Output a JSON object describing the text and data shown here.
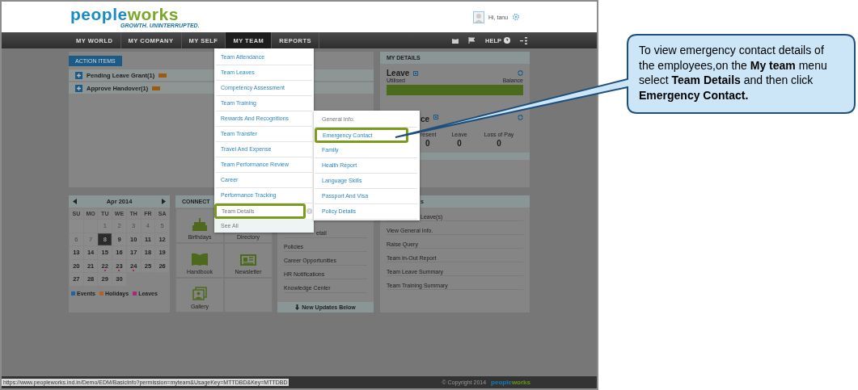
{
  "header": {
    "logo": "peopleworks",
    "tagline": "GROWTH. UNINTERRUPTED.",
    "greeting": "Hi, tanu"
  },
  "nav": {
    "items": [
      {
        "label": "MY WORLD",
        "selected": false
      },
      {
        "label": "MY COMPANY",
        "selected": false
      },
      {
        "label": "MY SELF",
        "selected": false
      },
      {
        "label": "MY TEAM",
        "selected": true
      },
      {
        "label": "REPORTS",
        "selected": false
      }
    ],
    "help": "HELP"
  },
  "action_items": {
    "tab": "ACTION ITEMS",
    "items": [
      {
        "label": "Pending Leave Grant(1)"
      },
      {
        "label": "Approve Handover(1)"
      }
    ]
  },
  "my_details": {
    "title": "MY DETAILS",
    "leave": {
      "title": "Leave",
      "utilised": "Utilised",
      "balance": "Balance",
      "level": 1
    },
    "attendance": {
      "title": "ce",
      "stats": [
        {
          "label": "resent",
          "value": "0"
        },
        {
          "label": "Leave",
          "value": "0"
        },
        {
          "label": "Loss of Pay",
          "value": "0"
        }
      ]
    }
  },
  "calendar": {
    "month": "Apr 2014",
    "weekdays": [
      "SU",
      "MO",
      "TU",
      "WE",
      "TH",
      "FR",
      "SA"
    ],
    "cells": [
      {
        "kind": "blank"
      },
      {
        "kind": "blank"
      },
      {
        "kind": "day",
        "day": "1",
        "muted": true,
        "selected": false
      },
      {
        "kind": "day",
        "day": "2",
        "muted": true,
        "selected": false
      },
      {
        "kind": "day",
        "day": "3",
        "muted": true,
        "selected": false
      },
      {
        "kind": "day",
        "day": "4",
        "muted": true,
        "selected": false
      },
      {
        "kind": "day",
        "day": "5",
        "muted": true,
        "selected": false
      },
      {
        "kind": "day",
        "day": "6",
        "muted": true,
        "selected": false
      },
      {
        "kind": "day",
        "day": "7",
        "muted": true,
        "selected": false
      },
      {
        "kind": "day",
        "day": "8",
        "muted": false,
        "selected": true
      },
      {
        "kind": "day",
        "day": "9",
        "muted": false,
        "selected": false
      },
      {
        "kind": "day",
        "day": "10",
        "muted": false,
        "selected": false
      },
      {
        "kind": "day",
        "day": "11",
        "muted": false,
        "selected": false
      },
      {
        "kind": "day",
        "day": "12",
        "muted": false,
        "selected": false
      },
      {
        "kind": "day",
        "day": "13",
        "muted": false,
        "selected": false
      },
      {
        "kind": "day",
        "day": "14",
        "muted": false,
        "selected": false
      },
      {
        "kind": "day",
        "day": "15",
        "muted": false,
        "selected": false
      },
      {
        "kind": "day",
        "day": "16",
        "muted": false,
        "selected": false
      },
      {
        "kind": "day",
        "day": "17",
        "muted": false,
        "selected": false
      },
      {
        "kind": "day",
        "day": "18",
        "muted": false,
        "selected": false
      },
      {
        "kind": "day",
        "day": "19",
        "muted": false,
        "selected": false
      },
      {
        "kind": "day",
        "day": "20",
        "muted": false,
        "selected": false
      },
      {
        "kind": "day",
        "day": "21",
        "muted": false,
        "selected": false
      },
      {
        "kind": "day",
        "day": "22",
        "muted": false,
        "selected": false,
        "color": "#a8287a"
      },
      {
        "kind": "day",
        "day": "23",
        "muted": false,
        "selected": false,
        "color": "#a8287a"
      },
      {
        "kind": "day",
        "day": "24",
        "muted": false,
        "selected": false,
        "color": "#a8287a"
      },
      {
        "kind": "day",
        "day": "25",
        "muted": false,
        "selected": false
      },
      {
        "kind": "day",
        "day": "26",
        "muted": false,
        "selected": false
      },
      {
        "kind": "day",
        "day": "27",
        "muted": false,
        "selected": false
      },
      {
        "kind": "day",
        "day": "28",
        "muted": false,
        "selected": false
      },
      {
        "kind": "day",
        "day": "29",
        "muted": false,
        "selected": false
      },
      {
        "kind": "day",
        "day": "30",
        "muted": false,
        "selected": false
      }
    ],
    "legend": [
      {
        "label": "Events",
        "color": "#1f63a0"
      },
      {
        "label": "Holidays",
        "color": "#b0621e"
      },
      {
        "label": "Leaves",
        "color": "#a8287a"
      }
    ]
  },
  "connect": {
    "title": "CONNECT",
    "tiles": [
      {
        "kind": "cake",
        "label": "Birthdays"
      },
      {
        "kind": "none",
        "label": "Directory"
      },
      {
        "kind": "book",
        "label": "Handbook"
      },
      {
        "kind": "news",
        "label": "Newsletter"
      },
      {
        "kind": "gallery",
        "label": "Gallery"
      }
    ]
  },
  "news": {
    "items": [
      "etail",
      "Policies",
      "Career Opportunities",
      "HR Notifications",
      "Knowledge Center"
    ],
    "footer": "New Updates Below"
  },
  "team_panel": {
    "title": "s",
    "items": [
      "Leave(s)",
      "View General Info.",
      "Raise Query",
      "Team In-Out Report",
      "Team Leave Summary",
      "Team Training Summary"
    ]
  },
  "team_menu": {
    "items": [
      {
        "label": "Team Attendance",
        "selected": false,
        "annotated": false
      },
      {
        "label": "Team Leaves",
        "selected": false,
        "annotated": false
      },
      {
        "label": "Competency Assessment",
        "selected": false,
        "annotated": false
      },
      {
        "label": "Team Training",
        "selected": false,
        "annotated": false
      },
      {
        "label": "Rewards And Recognitions",
        "selected": false,
        "annotated": false
      },
      {
        "label": "Team Transfer",
        "selected": false,
        "annotated": false
      },
      {
        "label": "Travel And Expense",
        "selected": false,
        "annotated": false
      },
      {
        "label": "Team Performance Review",
        "selected": false,
        "annotated": false
      },
      {
        "label": "Career",
        "selected": false,
        "annotated": false
      },
      {
        "label": "Performance Tracking",
        "selected": false,
        "annotated": false
      },
      {
        "label": "Team Details",
        "selected": true,
        "annotated": true
      }
    ],
    "see_all": "See All"
  },
  "submenu": {
    "items": [
      {
        "label": "General Info.",
        "selected": true,
        "annotated": false
      },
      {
        "label": "Emergency Contact",
        "selected": false,
        "annotated": true
      },
      {
        "label": "Family",
        "selected": false,
        "annotated": false
      },
      {
        "label": "Health Report",
        "selected": false,
        "annotated": false
      },
      {
        "label": "Language Skills",
        "selected": false,
        "annotated": false
      },
      {
        "label": "Passport And Visa",
        "selected": false,
        "annotated": false
      },
      {
        "label": "Policy Details",
        "selected": false,
        "annotated": false
      }
    ]
  },
  "status_bar": {
    "url": "https://www.peopleworks.ind.in/Demo/EDM/BasicInfo?permission=myteam&UsageKey=MTTDBD&Key=MTTDBD",
    "copyright": "© Copyright 2014",
    "logo": "peopleworks"
  },
  "callout": {
    "text": "To view emergency contact details of the employees,on the **My team** menu select **Team Details** and then click **Emergency Contact.**"
  }
}
